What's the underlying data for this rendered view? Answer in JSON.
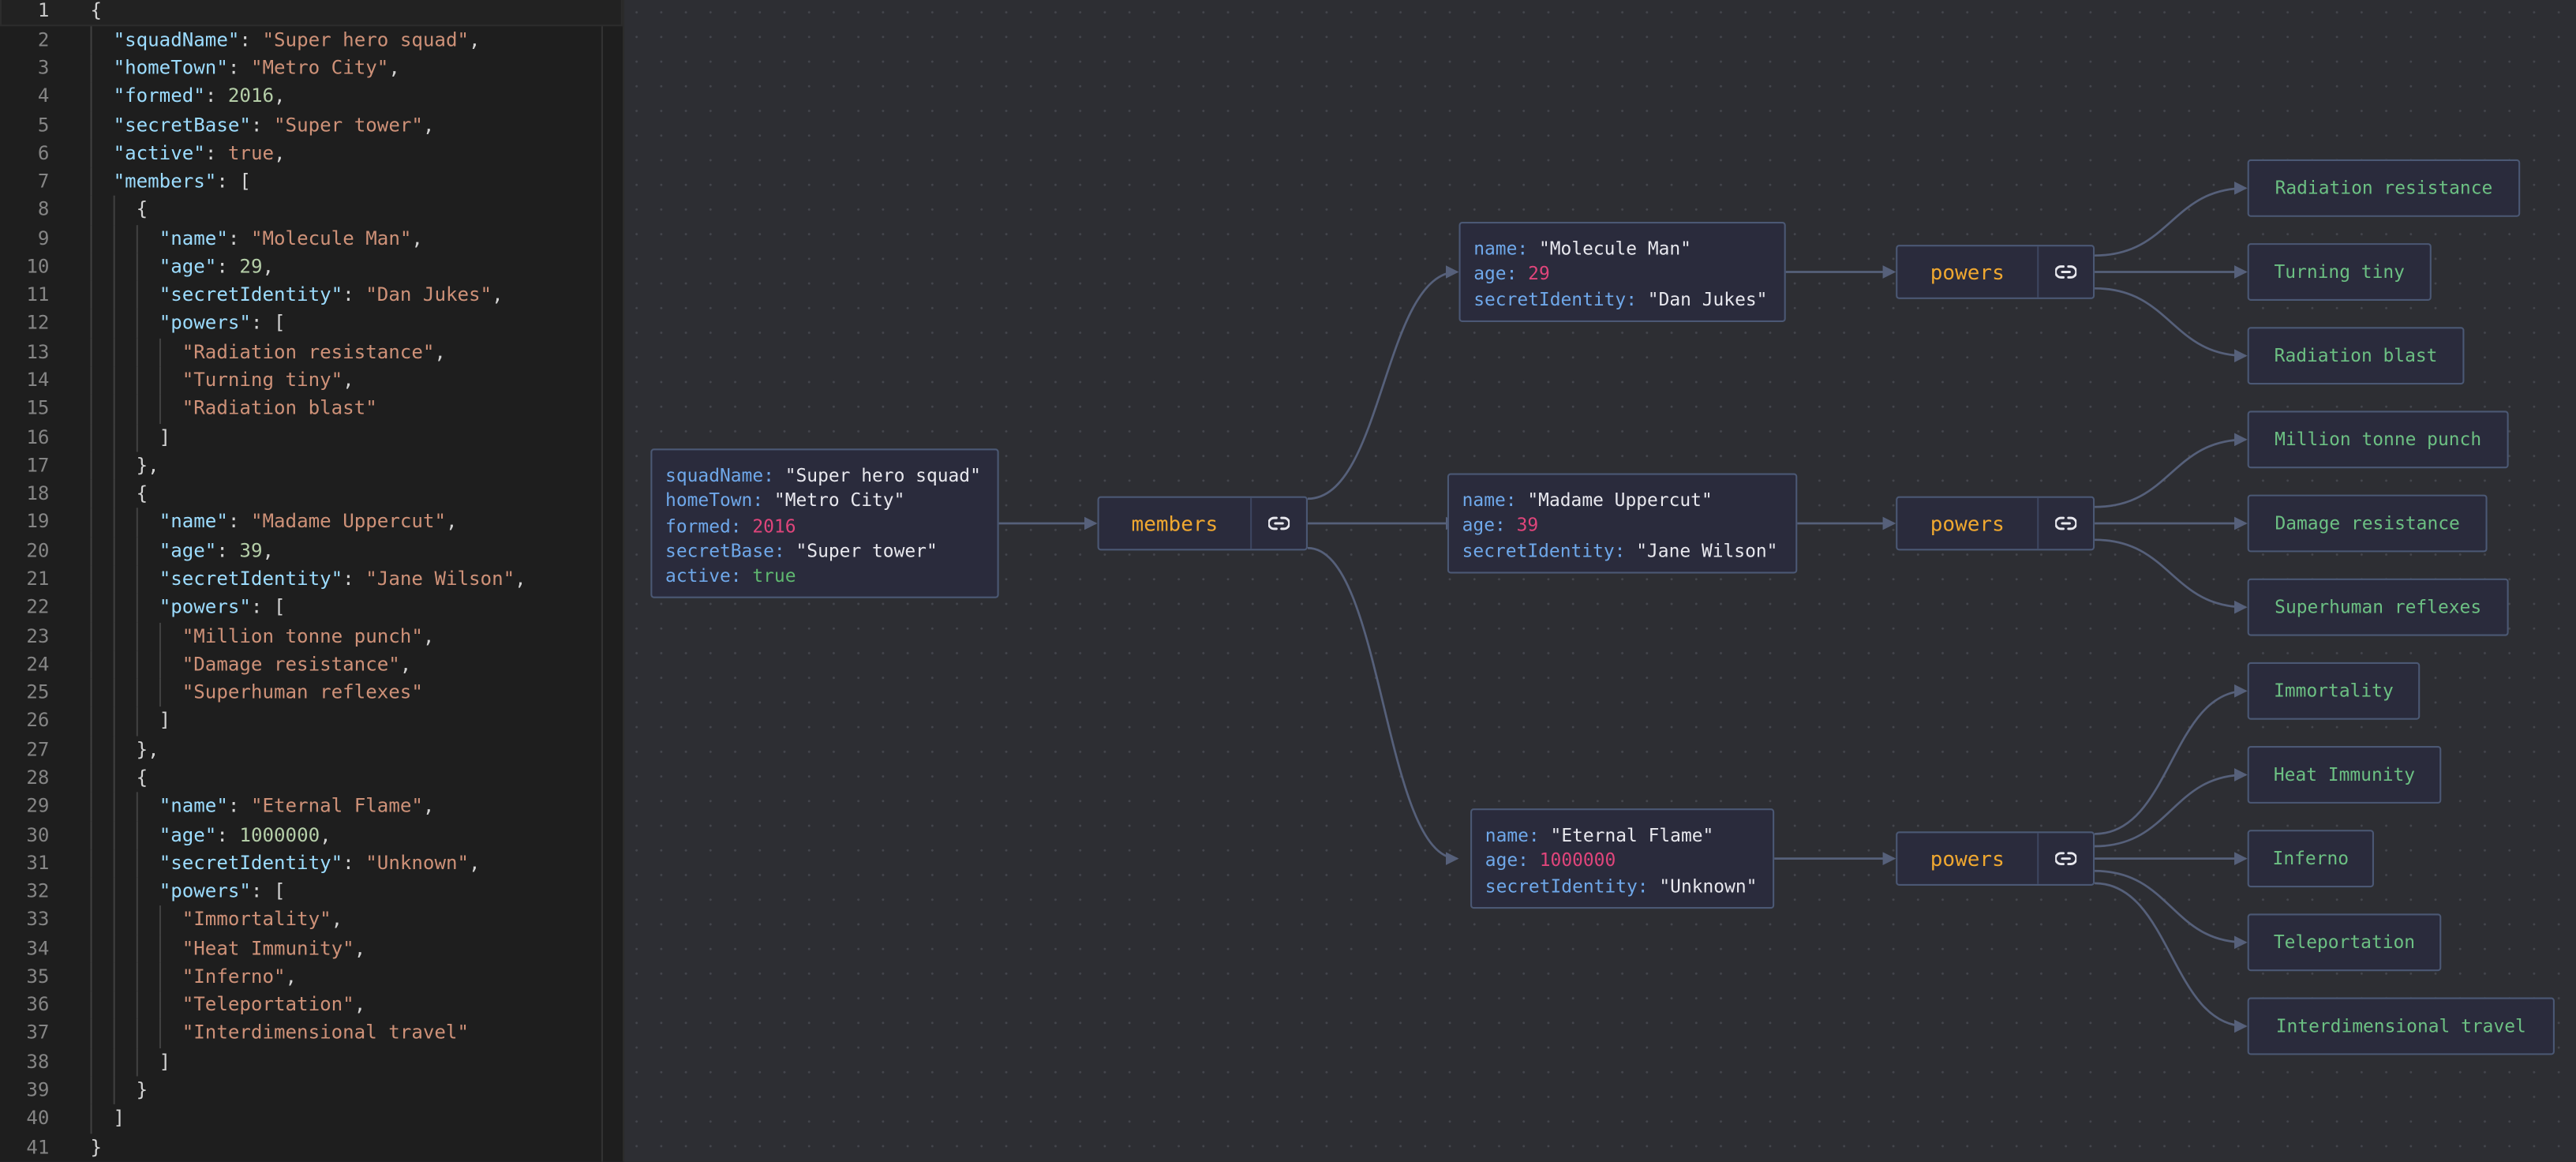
{
  "editor": {
    "active_line": 1,
    "lines": [
      "{",
      "  \"squadName\": \"Super hero squad\",",
      "  \"homeTown\": \"Metro City\",",
      "  \"formed\": 2016,",
      "  \"secretBase\": \"Super tower\",",
      "  \"active\": true,",
      "  \"members\": [",
      "    {",
      "      \"name\": \"Molecule Man\",",
      "      \"age\": 29,",
      "      \"secretIdentity\": \"Dan Jukes\",",
      "      \"powers\": [",
      "        \"Radiation resistance\",",
      "        \"Turning tiny\",",
      "        \"Radiation blast\"",
      "      ]",
      "    },",
      "    {",
      "      \"name\": \"Madame Uppercut\",",
      "      \"age\": 39,",
      "      \"secretIdentity\": \"Jane Wilson\",",
      "      \"powers\": [",
      "        \"Million tonne punch\",",
      "        \"Damage resistance\",",
      "        \"Superhuman reflexes\"",
      "      ]",
      "    },",
      "    {",
      "      \"name\": \"Eternal Flame\",",
      "      \"age\": 1000000,",
      "      \"secretIdentity\": \"Unknown\",",
      "      \"powers\": [",
      "        \"Immortality\",",
      "        \"Heat Immunity\",",
      "        \"Inferno\",",
      "        \"Teleportation\",",
      "        \"Interdimensional travel\"",
      "      ]",
      "    }",
      "  ]",
      "}"
    ]
  },
  "graph": {
    "root": {
      "fields": [
        {
          "key": "squadName",
          "value": "\"Super hero squad\"",
          "type": "string"
        },
        {
          "key": "homeTown",
          "value": "\"Metro City\"",
          "type": "string"
        },
        {
          "key": "formed",
          "value": "2016",
          "type": "number"
        },
        {
          "key": "secretBase",
          "value": "\"Super tower\"",
          "type": "string"
        },
        {
          "key": "active",
          "value": "true",
          "type": "boolean"
        }
      ]
    },
    "members_label": "members",
    "link_icon": "link-icon",
    "members": [
      {
        "fields": [
          {
            "key": "name",
            "value": "\"Molecule Man\"",
            "type": "string"
          },
          {
            "key": "age",
            "value": "29",
            "type": "number"
          },
          {
            "key": "secretIdentity",
            "value": "\"Dan Jukes\"",
            "type": "string"
          }
        ],
        "powers_label": "powers",
        "powers": [
          "Radiation resistance",
          "Turning tiny",
          "Radiation blast"
        ]
      },
      {
        "fields": [
          {
            "key": "name",
            "value": "\"Madame Uppercut\"",
            "type": "string"
          },
          {
            "key": "age",
            "value": "39",
            "type": "number"
          },
          {
            "key": "secretIdentity",
            "value": "\"Jane Wilson\"",
            "type": "string"
          }
        ],
        "powers_label": "powers",
        "powers": [
          "Million tonne punch",
          "Damage resistance",
          "Superhuman reflexes"
        ]
      },
      {
        "fields": [
          {
            "key": "name",
            "value": "\"Eternal Flame\"",
            "type": "string"
          },
          {
            "key": "age",
            "value": "1000000",
            "type": "number"
          },
          {
            "key": "secretIdentity",
            "value": "\"Unknown\"",
            "type": "string"
          }
        ],
        "powers_label": "powers",
        "powers": [
          "Immortality",
          "Heat Immunity",
          "Inferno",
          "Teleportation",
          "Interdimensional travel"
        ]
      }
    ],
    "colors": {
      "key": "#6fa8ea",
      "string": "#e8e8ee",
      "number": "#e0457b",
      "boolean": "#5fb870",
      "array_label": "#f0a830",
      "leaf": "#6cc083",
      "edge": "#56607a"
    }
  }
}
